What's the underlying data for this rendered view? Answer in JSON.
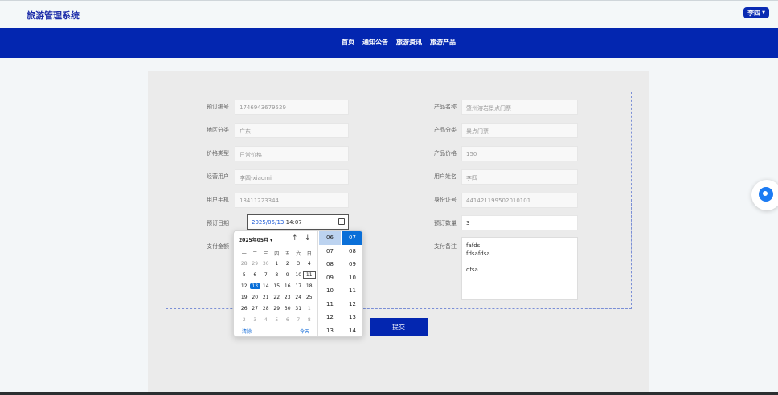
{
  "header": {
    "brand": "旅游管理系统",
    "user": "李四"
  },
  "nav": [
    "首页",
    "通知公告",
    "旅游资讯",
    "旅游产品"
  ],
  "form": {
    "left": [
      {
        "label": "预订编号",
        "value": "1746943679529"
      },
      {
        "label": "地区分类",
        "value": "广东"
      },
      {
        "label": "价格类型",
        "value": "日常价格"
      },
      {
        "label": "经营用户",
        "value": "李四-xiaomi"
      },
      {
        "label": "用户手机",
        "value": "13411223344"
      },
      {
        "label": "预订日期"
      },
      {
        "label": "支付金额"
      }
    ],
    "date": {
      "date_part": "2025/05/13",
      "time_part": " 14:07"
    },
    "right": [
      {
        "label": "产品名称",
        "value": "肇州溶岩景点门票"
      },
      {
        "label": "产品分类",
        "value": "景点门票"
      },
      {
        "label": "产品价格",
        "value": "150"
      },
      {
        "label": "用户姓名",
        "value": "李四"
      },
      {
        "label": "身份证号",
        "value": "441421199502010101"
      },
      {
        "label": "预订数量",
        "value": "3"
      },
      {
        "label": "支付备注",
        "value": "fafds\nfdsafdsa\n\ndfsa"
      }
    ],
    "submit": "提交"
  },
  "picker": {
    "header": "2025年05月",
    "weekdays": [
      "一",
      "二",
      "三",
      "四",
      "五",
      "六",
      "日"
    ],
    "weeks": [
      [
        "28",
        "29",
        "30",
        "1",
        "2",
        "3",
        "4"
      ],
      [
        "5",
        "6",
        "7",
        "8",
        "9",
        "10",
        "11"
      ],
      [
        "12",
        "13",
        "14",
        "15",
        "16",
        "17",
        "18"
      ],
      [
        "19",
        "20",
        "21",
        "22",
        "23",
        "24",
        "25"
      ],
      [
        "26",
        "27",
        "28",
        "29",
        "30",
        "31",
        "1"
      ],
      [
        "2",
        "3",
        "4",
        "5",
        "6",
        "7",
        "8"
      ]
    ],
    "clear": "清除",
    "today": "今天",
    "hours": [
      "06",
      "07",
      "08",
      "09",
      "10",
      "11",
      "12",
      "13"
    ],
    "minutes": [
      "07",
      "08",
      "09",
      "10",
      "11",
      "12",
      "13",
      "14"
    ],
    "selected_day": "13",
    "boxed_day": "11"
  },
  "colors": {
    "primary": "#0326b0",
    "accent": "#0a6fd8"
  }
}
